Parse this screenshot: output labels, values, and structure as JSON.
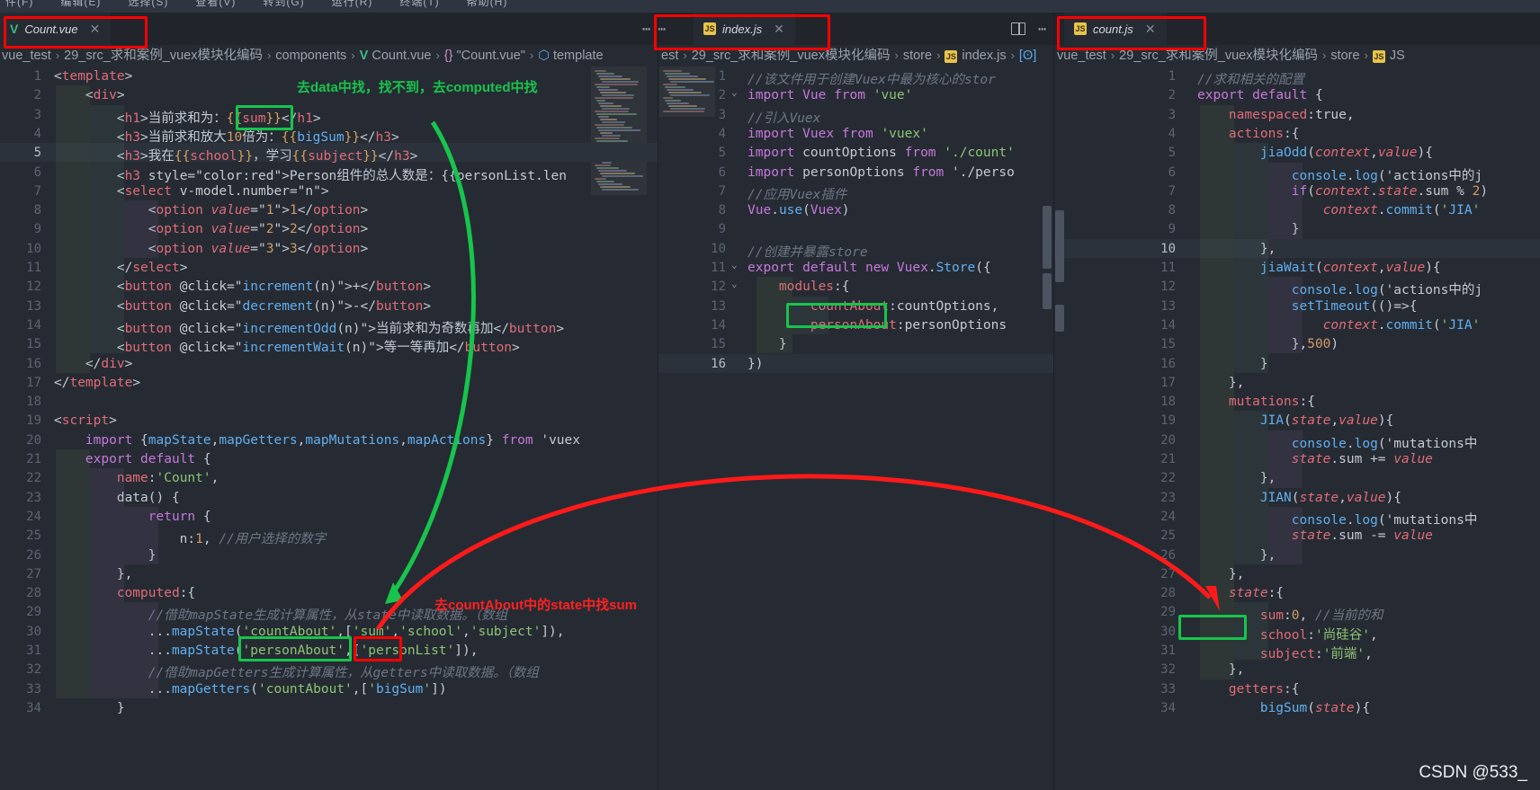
{
  "window": {
    "menubar_items": [
      "件(F)",
      "编辑(E)",
      "选择(S)",
      "查看(V)",
      "转到(G)",
      "运行(R)",
      "终端(T)",
      "帮助(H)"
    ],
    "watermark": "CSDN @533_"
  },
  "panes": [
    {
      "id": "pane-count-vue",
      "tab": {
        "label": "Count.vue",
        "icon": "vue-icon",
        "close": "✕",
        "active": true
      },
      "breadcrumb": [
        {
          "text": "vue_test",
          "kind": "plain"
        },
        {
          "text": "29_src_求和案例_vuex模块化编码",
          "kind": "plain"
        },
        {
          "text": "components",
          "kind": "plain"
        },
        {
          "text": "Count.vue",
          "kind": "vue"
        },
        {
          "text": "\"Count.vue\"",
          "kind": "brace"
        },
        {
          "text": "template",
          "kind": "cube"
        }
      ],
      "first_line": 1,
      "lines": [
        "<template>",
        "    <div>",
        "        <h1>当前求和为：{{sum}}</h1>",
        "        <h3>当前求和放大10倍为：{{bigSum}}</h3>",
        "        <h3>我在{{school}}，学习{{subject}}</h3>",
        "        <h3 style=\"color:red\">Person组件的总人数是：{{personList.len",
        "        <select v-model.number=\"n\">",
        "            <option value=\"1\">1</option>",
        "            <option value=\"2\">2</option>",
        "            <option value=\"3\">3</option>",
        "        </select>",
        "        <button @click=\"increment(n)\">+</button>",
        "        <button @click=\"decrement(n)\">-</button>",
        "        <button @click=\"incrementOdd(n)\">当前求和为奇数再加</button>",
        "        <button @click=\"incrementWait(n)\">等一等再加</button>",
        "    </div>",
        "</template>",
        "",
        "<script>",
        "    import {mapState,mapGetters,mapMutations,mapActions} from 'vuex",
        "    export default {",
        "        name:'Count',",
        "        data() {",
        "            return {",
        "                n:1, //用户选择的数字",
        "            }",
        "        },",
        "        computed:{",
        "            //借助mapState生成计算属性，从state中读取数据。（数组",
        "            ...mapState('countAbout',['sum','school','subject']),",
        "            ...mapState('personAbout',['personList']),",
        "            //借助mapGetters生成计算属性，从getters中读取数据。（数组",
        "            ...mapGetters('countAbout',['bigSum'])",
        "        }"
      ]
    },
    {
      "id": "pane-index-js",
      "tab": {
        "label": "index.js",
        "icon": "js-icon",
        "close": "✕",
        "active": true
      },
      "breadcrumb": [
        {
          "text": "est",
          "kind": "plain"
        },
        {
          "text": "29_src_求和案例_vuex模块化编码",
          "kind": "plain"
        },
        {
          "text": "store",
          "kind": "plain"
        },
        {
          "text": "index.js",
          "kind": "js"
        },
        {
          "text": "",
          "kind": "module"
        }
      ],
      "first_line": 1,
      "lines": [
        "//该文件用于创建Vuex中最为核心的stor",
        "import Vue from 'vue'",
        "//引入Vuex",
        "import Vuex from 'vuex'",
        "import countOptions from './count'",
        "import personOptions from './perso",
        "//应用Vuex插件",
        "Vue.use(Vuex)",
        "",
        "//创建并暴露store",
        "export default new Vuex.Store({",
        "    modules:{",
        "        countAbout:countOptions,",
        "        personAbout:personOptions",
        "    }",
        "})"
      ]
    },
    {
      "id": "pane-count-js",
      "tab": {
        "label": "count.js",
        "icon": "js-icon",
        "close": "✕",
        "active": true
      },
      "breadcrumb": [
        {
          "text": "vue_test",
          "kind": "plain"
        },
        {
          "text": "29_src_求和案例_vuex模块化编码",
          "kind": "plain"
        },
        {
          "text": "store",
          "kind": "plain"
        },
        {
          "text": "JS",
          "kind": "js"
        }
      ],
      "first_line": 1,
      "lines": [
        "//求和相关的配置",
        "export default {",
        "    namespaced:true,",
        "    actions:{",
        "        jiaOdd(context,value){",
        "            console.log('actions中的j",
        "            if(context.state.sum % 2)",
        "                context.commit('JIA'",
        "            }",
        "        },",
        "        jiaWait(context,value){",
        "            console.log('actions中的j",
        "            setTimeout(()=>{",
        "                context.commit('JIA'",
        "            },500)",
        "        }",
        "    },",
        "    mutations:{",
        "        JIA(state,value){",
        "            console.log('mutations中",
        "            state.sum += value",
        "        },",
        "        JIAN(state,value){",
        "            console.log('mutations中",
        "            state.sum -= value",
        "        },",
        "    },",
        "    state:{",
        "        sum:0, //当前的和",
        "        school:'尚硅谷',",
        "        subject:'前端',",
        "    },",
        "    getters:{",
        "        bigSum(state){"
      ]
    }
  ],
  "annotations": {
    "notes": [
      {
        "id": "note-data-computed",
        "text": "去data中找，找不到，去computed中找",
        "color": "#17c44c"
      },
      {
        "id": "note-countabout-state-sum",
        "text": "去countAbout中的state中找sum",
        "color": "#ff2020"
      }
    ],
    "boxes": [
      {
        "id": "box-tab-count-vue",
        "color": "#ff0000"
      },
      {
        "id": "box-tab-index-js",
        "color": "#ff0000"
      },
      {
        "id": "box-tab-count-js",
        "color": "#ff0000"
      },
      {
        "id": "box-sum-mustache",
        "color": "#17c44c"
      },
      {
        "id": "box-mapstate-countabout",
        "color": "#17c44c"
      },
      {
        "id": "box-mapstate-sum",
        "color": "#ff0000"
      },
      {
        "id": "box-modules-countabout",
        "color": "#17c44c"
      },
      {
        "id": "box-state-sum",
        "color": "#17c44c"
      }
    ],
    "arrows": [
      {
        "id": "arrow-sum-to-computed",
        "color": "#17c44c"
      },
      {
        "id": "arrow-computed-to-state",
        "color": "#ff0000"
      }
    ]
  }
}
